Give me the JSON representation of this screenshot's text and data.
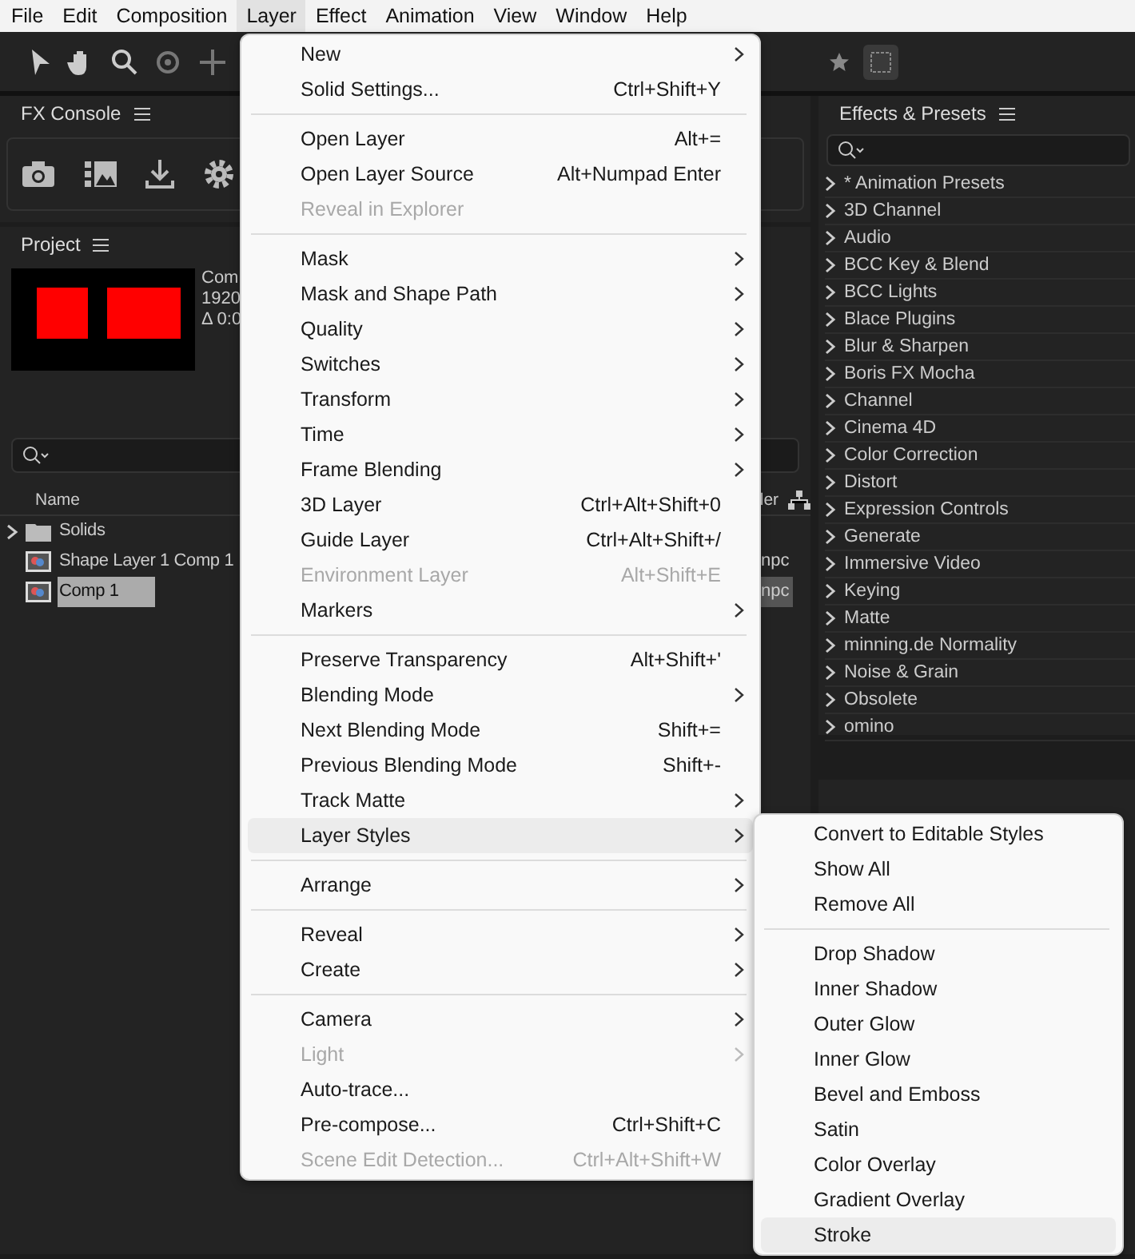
{
  "menu_bar": [
    {
      "label": "File",
      "selected": false
    },
    {
      "label": "Edit",
      "selected": false
    },
    {
      "label": "Composition",
      "selected": false
    },
    {
      "label": "Layer",
      "selected": true
    },
    {
      "label": "Effect",
      "selected": false
    },
    {
      "label": "Animation",
      "selected": false
    },
    {
      "label": "View",
      "selected": false
    },
    {
      "label": "Window",
      "selected": false
    },
    {
      "label": "Help",
      "selected": false
    }
  ],
  "fx_console": {
    "title": "FX Console"
  },
  "project": {
    "title": "Project",
    "comp_info": [
      "Com",
      "1920",
      "Δ 0:0"
    ],
    "column_name": "Name",
    "column_2": "ler",
    "items": [
      {
        "name": "Solids",
        "kind": "folder",
        "selected": false
      },
      {
        "name": "Shape Layer 1 Comp 1",
        "kind": "comp",
        "selected": false,
        "column_2": "npc"
      },
      {
        "name": "Comp 1",
        "kind": "comp",
        "selected": true,
        "column_2": "npc"
      }
    ]
  },
  "effects_presets": {
    "title": "Effects & Presets",
    "items": [
      "* Animation Presets",
      "3D Channel",
      "Audio",
      "BCC Key & Blend",
      "BCC Lights",
      "Blace Plugins",
      "Blur & Sharpen",
      "Boris FX Mocha",
      "Channel",
      "Cinema 4D",
      "Color Correction",
      "Distort",
      "Expression Controls",
      "Generate",
      "Immersive Video",
      "Keying",
      "Matte",
      "minning.de Normality",
      "Noise & Grain",
      "Obsolete",
      "omino"
    ]
  },
  "layer_menu": [
    {
      "kind": "item",
      "label": "New",
      "submenu": true,
      "disabled": false,
      "highlighted": false
    },
    {
      "kind": "item",
      "label": "Solid Settings...",
      "shortcut": "Ctrl+Shift+Y",
      "submenu": false,
      "disabled": false,
      "highlighted": false
    },
    {
      "kind": "separator"
    },
    {
      "kind": "item",
      "label": "Open Layer",
      "shortcut": "Alt+=",
      "submenu": false,
      "disabled": false,
      "highlighted": false
    },
    {
      "kind": "item",
      "label": "Open Layer Source",
      "shortcut": "Alt+Numpad Enter",
      "submenu": false,
      "disabled": false,
      "highlighted": false
    },
    {
      "kind": "item",
      "label": "Reveal in Explorer",
      "submenu": false,
      "disabled": true,
      "highlighted": false
    },
    {
      "kind": "separator"
    },
    {
      "kind": "item",
      "label": "Mask",
      "submenu": true,
      "disabled": false,
      "highlighted": false
    },
    {
      "kind": "item",
      "label": "Mask and Shape Path",
      "submenu": true,
      "disabled": false,
      "highlighted": false
    },
    {
      "kind": "item",
      "label": "Quality",
      "submenu": true,
      "disabled": false,
      "highlighted": false
    },
    {
      "kind": "item",
      "label": "Switches",
      "submenu": true,
      "disabled": false,
      "highlighted": false
    },
    {
      "kind": "item",
      "label": "Transform",
      "submenu": true,
      "disabled": false,
      "highlighted": false
    },
    {
      "kind": "item",
      "label": "Time",
      "submenu": true,
      "disabled": false,
      "highlighted": false
    },
    {
      "kind": "item",
      "label": "Frame Blending",
      "submenu": true,
      "disabled": false,
      "highlighted": false
    },
    {
      "kind": "item",
      "label": "3D Layer",
      "shortcut": "Ctrl+Alt+Shift+0",
      "submenu": false,
      "disabled": false,
      "highlighted": false
    },
    {
      "kind": "item",
      "label": "Guide Layer",
      "shortcut": "Ctrl+Alt+Shift+/",
      "submenu": false,
      "disabled": false,
      "highlighted": false
    },
    {
      "kind": "item",
      "label": "Environment Layer",
      "shortcut": "Alt+Shift+E",
      "submenu": false,
      "disabled": true,
      "highlighted": false
    },
    {
      "kind": "item",
      "label": "Markers",
      "submenu": true,
      "disabled": false,
      "highlighted": false
    },
    {
      "kind": "separator"
    },
    {
      "kind": "item",
      "label": "Preserve Transparency",
      "shortcut": "Alt+Shift+'",
      "submenu": false,
      "disabled": false,
      "highlighted": false
    },
    {
      "kind": "item",
      "label": "Blending Mode",
      "submenu": true,
      "disabled": false,
      "highlighted": false
    },
    {
      "kind": "item",
      "label": "Next Blending Mode",
      "shortcut": "Shift+=",
      "submenu": false,
      "disabled": false,
      "highlighted": false
    },
    {
      "kind": "item",
      "label": "Previous Blending Mode",
      "shortcut": "Shift+-",
      "submenu": false,
      "disabled": false,
      "highlighted": false
    },
    {
      "kind": "item",
      "label": "Track Matte",
      "submenu": true,
      "disabled": false,
      "highlighted": false
    },
    {
      "kind": "item",
      "label": "Layer Styles",
      "submenu": true,
      "disabled": false,
      "highlighted": true
    },
    {
      "kind": "separator"
    },
    {
      "kind": "item",
      "label": "Arrange",
      "submenu": true,
      "disabled": false,
      "highlighted": false
    },
    {
      "kind": "separator"
    },
    {
      "kind": "item",
      "label": "Reveal",
      "submenu": true,
      "disabled": false,
      "highlighted": false
    },
    {
      "kind": "item",
      "label": "Create",
      "submenu": true,
      "disabled": false,
      "highlighted": false
    },
    {
      "kind": "separator"
    },
    {
      "kind": "item",
      "label": "Camera",
      "submenu": true,
      "disabled": false,
      "highlighted": false
    },
    {
      "kind": "item",
      "label": "Light",
      "submenu": true,
      "disabled": true,
      "highlighted": false
    },
    {
      "kind": "item",
      "label": "Auto-trace...",
      "submenu": false,
      "disabled": false,
      "highlighted": false
    },
    {
      "kind": "item",
      "label": "Pre-compose...",
      "shortcut": "Ctrl+Shift+C",
      "submenu": false,
      "disabled": false,
      "highlighted": false
    },
    {
      "kind": "item",
      "label": "Scene Edit Detection...",
      "shortcut": "Ctrl+Alt+Shift+W",
      "submenu": false,
      "disabled": true,
      "highlighted": false
    }
  ],
  "layer_styles_submenu": [
    {
      "kind": "item",
      "label": "Convert to Editable Styles",
      "highlighted": false
    },
    {
      "kind": "item",
      "label": "Show All",
      "highlighted": false
    },
    {
      "kind": "item",
      "label": "Remove All",
      "highlighted": false
    },
    {
      "kind": "separator"
    },
    {
      "kind": "item",
      "label": "Drop Shadow",
      "highlighted": false
    },
    {
      "kind": "item",
      "label": "Inner Shadow",
      "highlighted": false
    },
    {
      "kind": "item",
      "label": "Outer Glow",
      "highlighted": false
    },
    {
      "kind": "item",
      "label": "Inner Glow",
      "highlighted": false
    },
    {
      "kind": "item",
      "label": "Bevel and Emboss",
      "highlighted": false
    },
    {
      "kind": "item",
      "label": "Satin",
      "highlighted": false
    },
    {
      "kind": "item",
      "label": "Color Overlay",
      "highlighted": false
    },
    {
      "kind": "item",
      "label": "Gradient Overlay",
      "highlighted": false
    },
    {
      "kind": "item",
      "label": "Stroke",
      "highlighted": true
    }
  ]
}
